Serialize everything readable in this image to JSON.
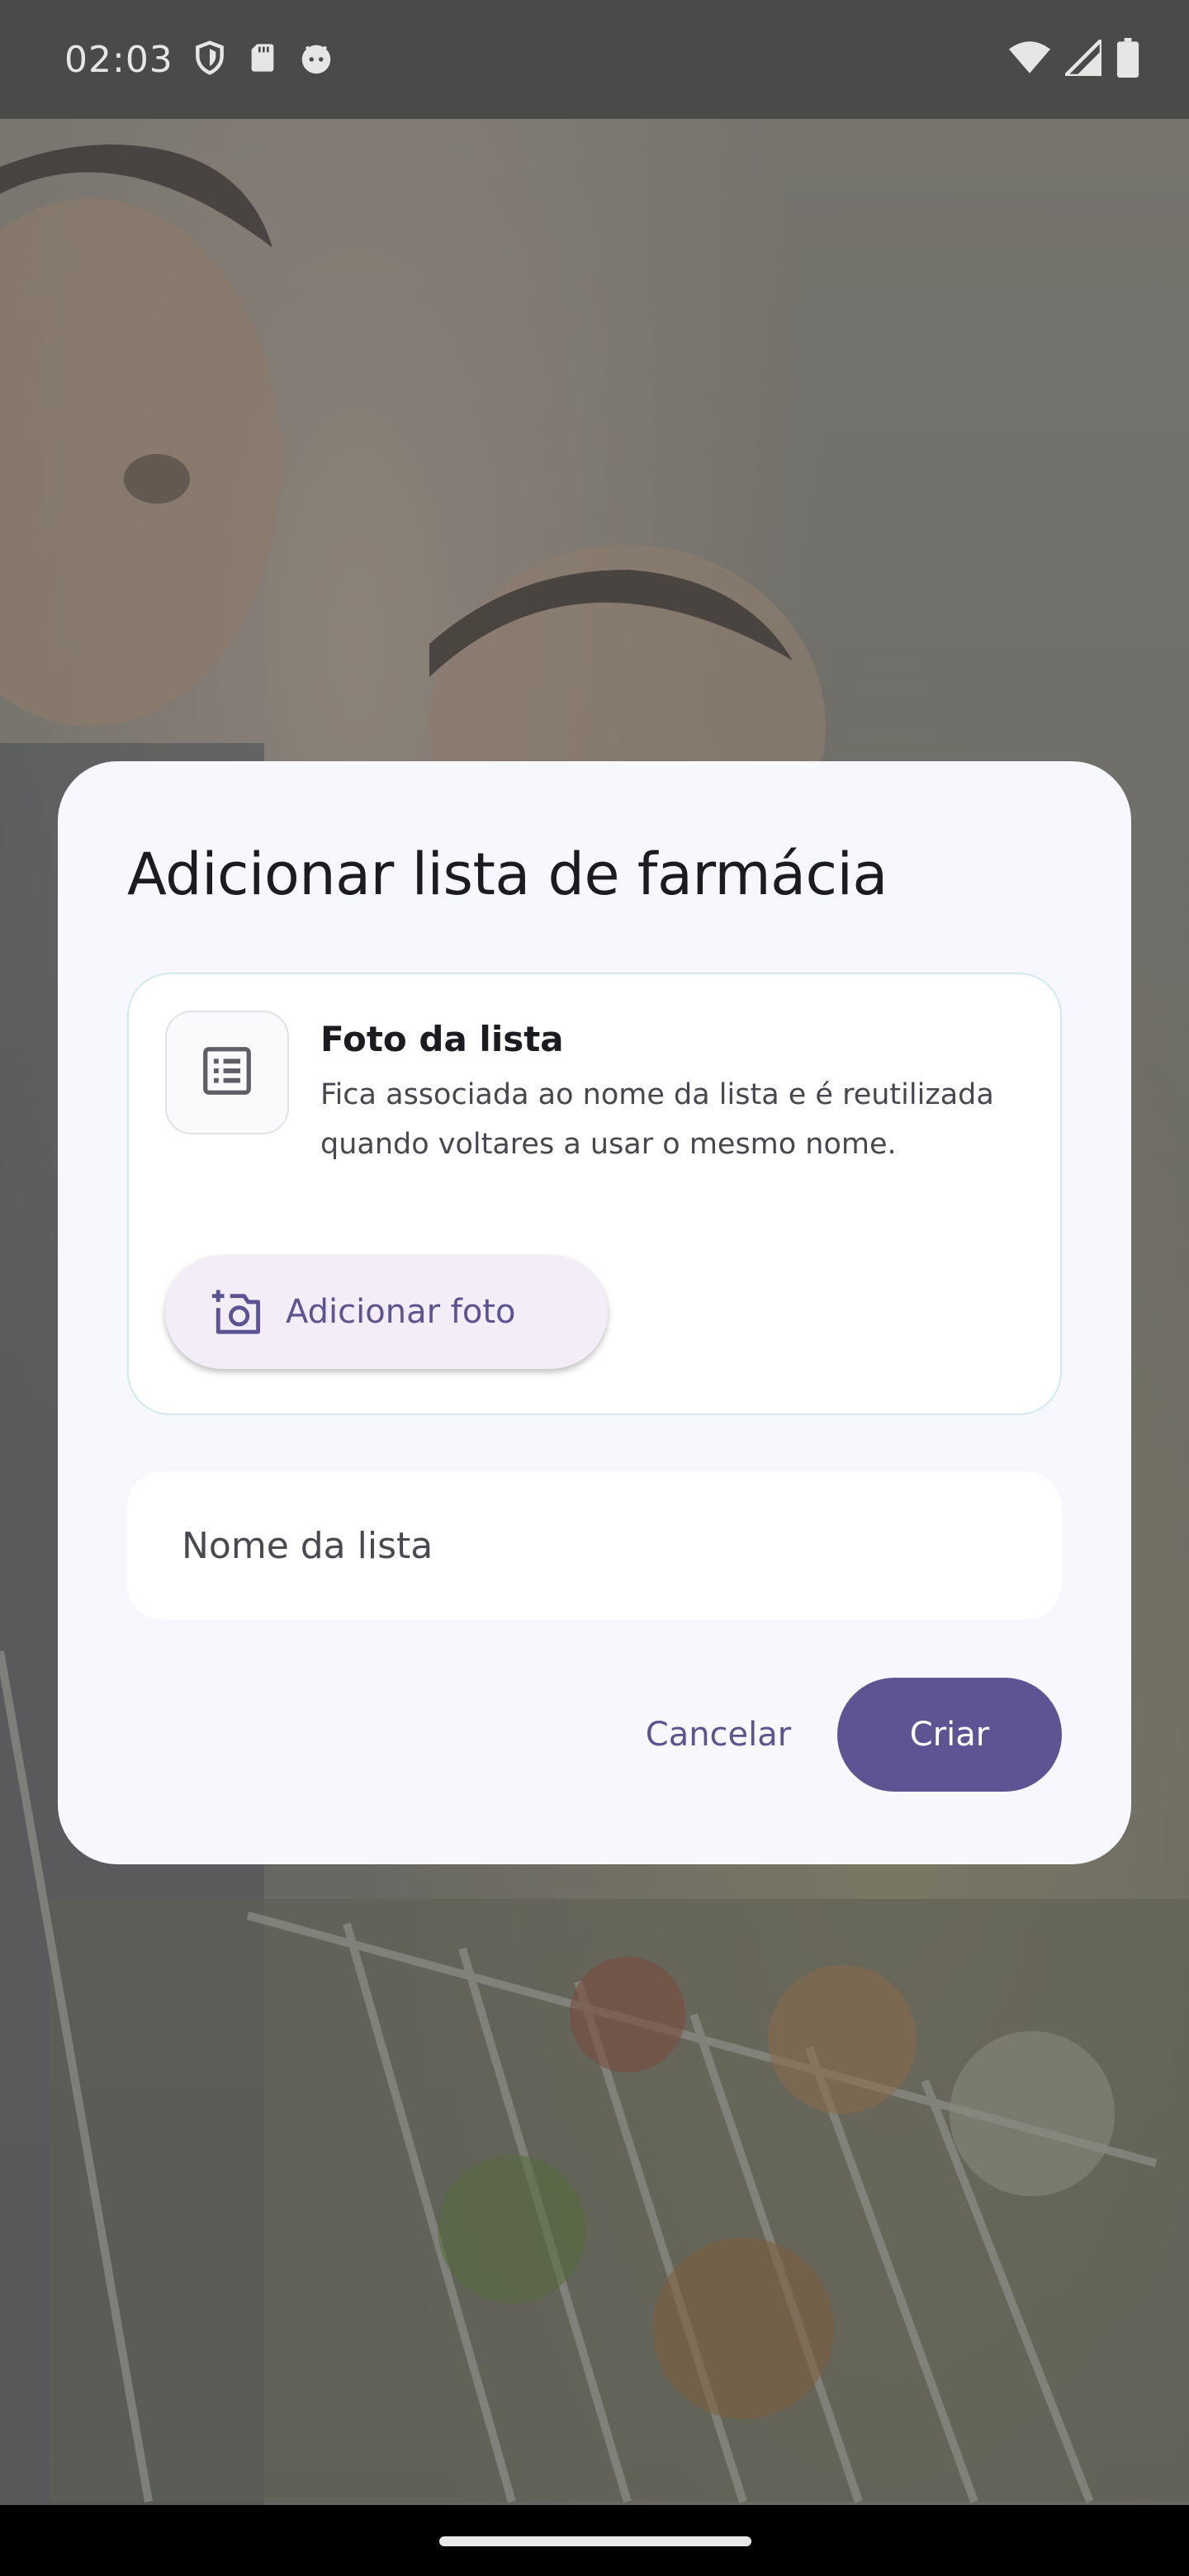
{
  "status_bar": {
    "time": "02:03",
    "left_icons": [
      "vpn-shield-icon",
      "sd-card-icon",
      "android-face-icon"
    ],
    "right_icons": [
      "wifi-icon",
      "signal-icon",
      "battery-icon"
    ]
  },
  "dialog": {
    "title": "Adicionar lista de farmácia",
    "photo_card": {
      "thumbnail_icon": "list-icon",
      "title": "Foto da lista",
      "description": "Fica associada ao nome da lista e é reutilizada quando voltares a usar o mesmo nome.",
      "add_photo_icon": "add-photo-camera-icon",
      "add_photo_label": "Adicionar foto"
    },
    "name_field": {
      "placeholder": "Nome da lista",
      "value": ""
    },
    "buttons": {
      "cancel": "Cancelar",
      "create": "Criar"
    }
  },
  "colors": {
    "primary": "#5e5494",
    "dialog_background": "#f7f8fd",
    "scrim": "#6b6a66",
    "card_border": "#cfe9ef"
  }
}
